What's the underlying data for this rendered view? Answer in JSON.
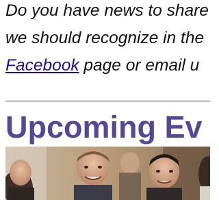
{
  "intro": {
    "line1": "Do you have news to share",
    "line2": "we should recognize in the",
    "link_label": "Facebook",
    "line3_rest": " page or email u"
  },
  "section": {
    "heading": "Upcoming Ev"
  },
  "photo": {
    "description_icon": "group-photo"
  },
  "colors": {
    "heading": "#55489a",
    "link": "#1a0dab",
    "text": "#111111"
  }
}
